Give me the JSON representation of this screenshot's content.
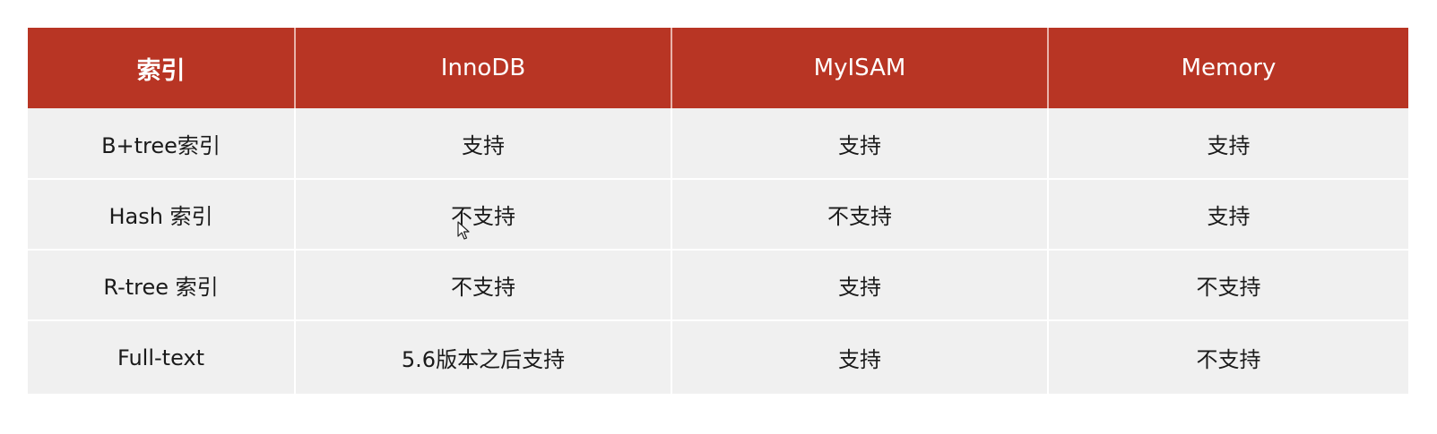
{
  "table": {
    "headers": [
      "索引",
      "InnoDB",
      "MyISAM",
      "Memory"
    ],
    "rows": [
      [
        "B+tree索引",
        "支持",
        "支持",
        "支持"
      ],
      [
        "Hash 索引",
        "不支持",
        "不支持",
        "支持"
      ],
      [
        "R-tree 索引",
        "不支持",
        "支持",
        "不支持"
      ],
      [
        "Full-text",
        "5.6版本之后支持",
        "支持",
        "不支持"
      ]
    ]
  },
  "colors": {
    "header_background": "#b83524",
    "header_text": "#ffffff",
    "cell_background": "#f0f0f0",
    "cell_text": "#1a1a1a"
  },
  "cursor": {
    "icon": "mouse-pointer-icon"
  }
}
